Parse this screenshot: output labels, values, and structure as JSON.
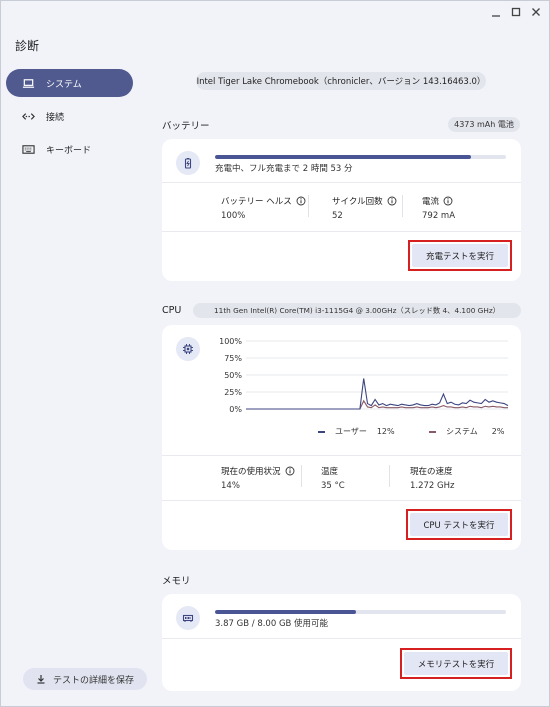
{
  "app": {
    "title": "診断"
  },
  "sidebar": {
    "items": [
      {
        "label": "システム",
        "icon": "laptop-icon",
        "active": true
      },
      {
        "label": "接続",
        "icon": "connectivity-icon",
        "active": false
      },
      {
        "label": "キーボード",
        "icon": "keyboard-icon",
        "active": false
      }
    ],
    "save_label": "テストの詳細を保存"
  },
  "device": {
    "info": "Intel Tiger Lake Chromebook（chronicler、バージョン 143.16463.0）"
  },
  "battery": {
    "section_label": "バッテリー",
    "capacity_badge": "4373 mAh 電池",
    "status": "充電中、フル充電まで 2 時間 53 分",
    "charge_fraction": 0.88,
    "stats": [
      {
        "label": "バッテリー ヘルス",
        "value": "100%"
      },
      {
        "label": "サイクル回数",
        "value": "52"
      },
      {
        "label": "電流",
        "value": "792 mA"
      }
    ],
    "run_label": "充電テストを実行"
  },
  "cpu": {
    "section_label": "CPU",
    "model_badge": "11th Gen Intel(R) Core(TM) i3-1115G4 @ 3.00GHz（スレッド数 4、4.100 GHz）",
    "legend": [
      {
        "name": "ユーザー",
        "value": "12%"
      },
      {
        "name": "システム",
        "value": "2%"
      }
    ],
    "stats": [
      {
        "label": "現在の使用状況",
        "value": "14%"
      },
      {
        "label": "温度",
        "value": "35 °C"
      },
      {
        "label": "現在の速度",
        "value": "1.272 GHz"
      }
    ],
    "run_label": "CPU テストを実行"
  },
  "memory": {
    "section_label": "メモリ",
    "status": "3.87 GB / 8.00 GB 使用可能",
    "available_fraction": 0.484,
    "run_label": "メモリテストを実行"
  },
  "colors": {
    "accent": "#4a5596",
    "user_series": "#3c4680",
    "system_series": "#8a5a66",
    "highlight": "#d62020"
  },
  "chart_data": {
    "type": "line",
    "ytick_labels": [
      "100%",
      "75%",
      "50%",
      "25%",
      "0%"
    ],
    "ylim": [
      0,
      100
    ],
    "x": [
      0,
      1,
      2,
      3,
      4,
      5,
      6,
      7,
      8,
      9,
      10,
      11,
      12,
      13,
      14,
      15,
      16,
      17,
      18,
      19,
      20,
      21,
      22,
      23,
      24,
      25,
      26,
      27,
      28,
      29,
      30,
      31,
      32,
      33,
      34,
      35,
      36,
      37,
      38,
      39,
      40,
      41,
      42,
      43,
      44,
      45,
      46,
      47,
      48,
      49,
      50,
      51,
      52,
      53,
      54,
      55,
      56,
      57,
      58,
      59,
      60,
      61,
      62,
      63,
      64,
      65,
      66,
      67,
      68,
      69
    ],
    "series": [
      {
        "name": "ユーザー",
        "values": [
          0,
          0,
          0,
          0,
          0,
          0,
          0,
          0,
          0,
          0,
          0,
          0,
          0,
          0,
          0,
          0,
          0,
          0,
          0,
          0,
          0,
          0,
          0,
          0,
          0,
          0,
          0,
          0,
          0,
          0,
          0,
          45,
          8,
          5,
          14,
          6,
          8,
          5,
          7,
          6,
          5,
          7,
          6,
          5,
          6,
          8,
          6,
          5,
          5,
          7,
          6,
          9,
          22,
          8,
          10,
          7,
          6,
          9,
          8,
          13,
          10,
          9,
          8,
          14,
          10,
          12,
          10,
          9,
          8,
          5
        ]
      },
      {
        "name": "システム",
        "values": [
          0,
          0,
          0,
          0,
          0,
          0,
          0,
          0,
          0,
          0,
          0,
          0,
          0,
          0,
          0,
          0,
          0,
          0,
          0,
          0,
          0,
          0,
          0,
          0,
          0,
          0,
          0,
          0,
          0,
          0,
          0,
          12,
          3,
          2,
          6,
          2,
          3,
          2,
          2,
          2,
          2,
          3,
          2,
          2,
          2,
          3,
          2,
          2,
          2,
          3,
          2,
          3,
          5,
          3,
          3,
          2,
          2,
          3,
          2,
          4,
          3,
          3,
          2,
          4,
          3,
          4,
          3,
          3,
          2,
          2
        ]
      }
    ]
  }
}
